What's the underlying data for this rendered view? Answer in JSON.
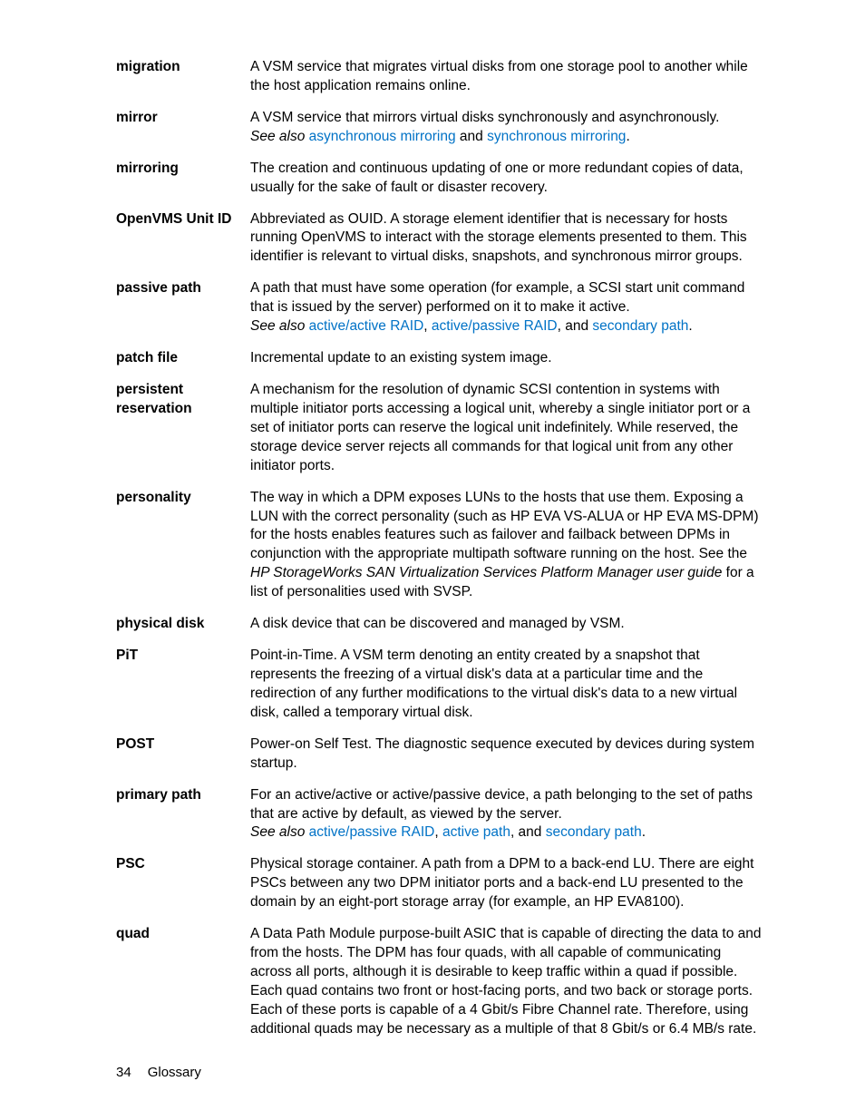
{
  "entries": {
    "migration": {
      "term": "migration",
      "def": "A VSM service that migrates virtual disks from one storage pool to another while the host application remains online."
    },
    "mirror": {
      "term": "mirror",
      "def": "A VSM service that mirrors virtual disks synchronously and asynchronously.",
      "see": {
        "label": "See also ",
        "l1": "asynchronous mirroring",
        "mid": " and ",
        "l2": "synchronous mirroring",
        "end": "."
      }
    },
    "mirroring": {
      "term": "mirroring",
      "def": "The creation and continuous updating of one or more redundant copies of data, usually for the sake of fault or disaster recovery."
    },
    "openvms": {
      "term": "OpenVMS Unit ID",
      "def": "Abbreviated as OUID. A storage element identifier that is necessary for hosts running OpenVMS to interact with the storage elements presented to them. This identifier is relevant to virtual disks, snapshots, and synchronous mirror groups."
    },
    "passive": {
      "term": "passive path",
      "def": "A path that must have some operation (for example, a SCSI start unit command that is issued by the server) performed on it to make it active.",
      "see": {
        "label": "See also ",
        "l1": "active/active RAID",
        "mid1": ", ",
        "l2": "active/passive RAID",
        "mid2": ", and ",
        "l3": "secondary path",
        "end": "."
      }
    },
    "patch": {
      "term": "patch file",
      "def": "Incremental update to an existing system image."
    },
    "persistent": {
      "term": "persistent reservation",
      "def": "A mechanism for the resolution of dynamic SCSI contention in systems with multiple initiator ports accessing a logical unit, whereby a single initiator port or a set of initiator ports can reserve the logical unit indefinitely. While reserved, the storage device server rejects all commands for that logical unit from any other initiator ports."
    },
    "personality": {
      "term": "personality",
      "pre": "The way in which a DPM exposes LUNs to the hosts that use them. Exposing a LUN with the correct personality (such as HP EVA VS-ALUA or HP EVA MS-DPM) for the hosts enables features such as failover and failback between DPMs in conjunction with the appropriate multipath software running on the host. See the ",
      "ital": "HP StorageWorks SAN Virtualization Services Platform Manager user guide",
      "post": " for a list of personalities used with SVSP."
    },
    "physical": {
      "term": "physical disk",
      "def": "A disk device that can be discovered and managed by VSM."
    },
    "pit": {
      "term": "PiT",
      "def": "Point-in-Time. A VSM term denoting an entity created by a snapshot that represents the freezing of a virtual disk's data at a particular time and the redirection of any further modifications to the virtual disk's data to a new virtual disk, called a temporary virtual disk."
    },
    "post": {
      "term": "POST",
      "def": "Power-on Self Test. The diagnostic sequence executed by devices during system startup."
    },
    "primary": {
      "term": "primary path",
      "def": "For an active/active or active/passive device, a path belonging to the set of paths that are active by default, as viewed by the server.",
      "see": {
        "label": "See also ",
        "l1": "active/passive RAID",
        "mid1": ", ",
        "l2": "active path",
        "mid2": ", and ",
        "l3": "secondary path",
        "end": "."
      }
    },
    "psc": {
      "term": "PSC",
      "def": "Physical storage container. A path from a DPM to a back-end LU. There are eight PSCs between any two DPM initiator ports and a back-end LU presented to the domain by an eight-port storage array (for example, an HP EVA8100)."
    },
    "quad": {
      "term": "quad",
      "def": "A Data Path Module purpose-built ASIC that is capable of directing the data to and from the hosts. The DPM has four quads, with all capable of communicating across all ports, although it is desirable to keep traffic within a quad if possible. Each quad contains two front or host-facing ports, and two back or storage ports. Each of these ports is capable of a 4 Gbit/s Fibre Channel rate. Therefore, using additional quads may be necessary as a multiple of that 8 Gbit/s or 6.4 MB/s rate."
    }
  },
  "footer": {
    "page": "34",
    "section": "Glossary"
  }
}
